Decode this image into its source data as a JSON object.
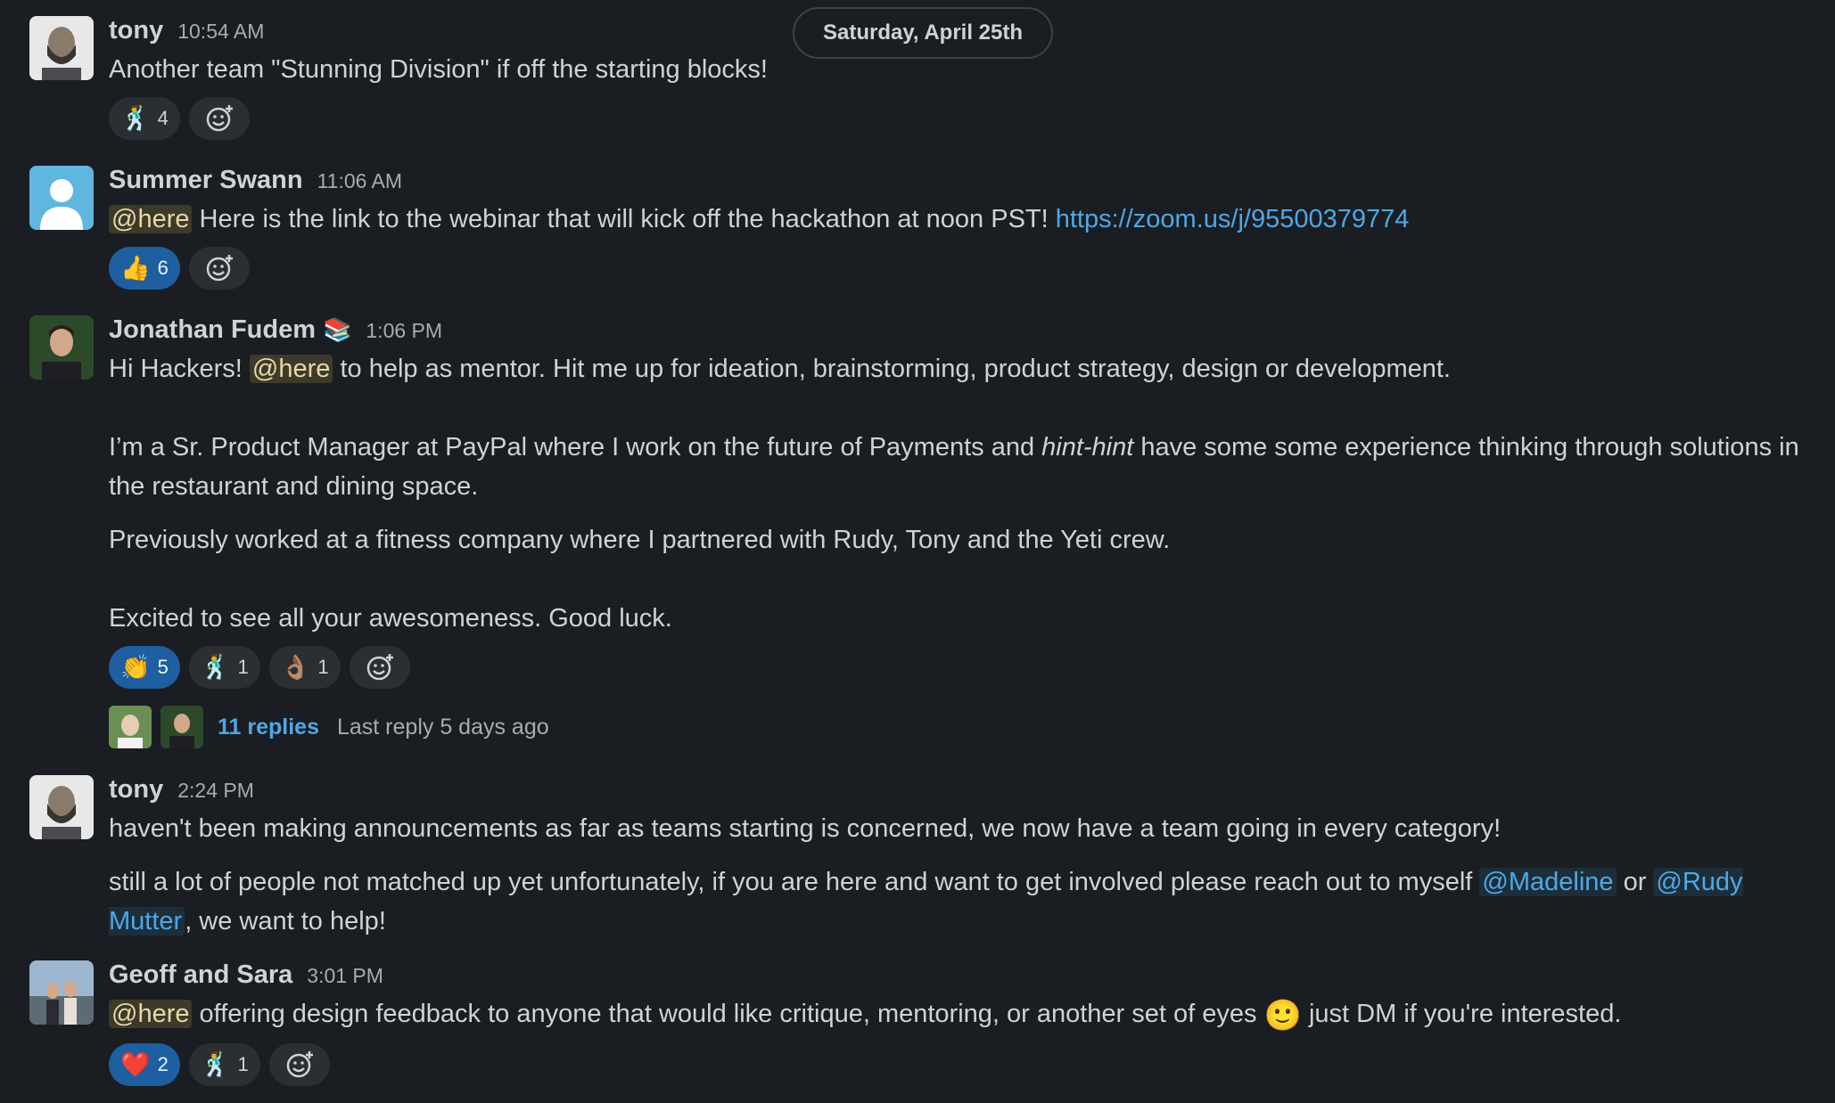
{
  "date_divider": "Saturday, April 25th",
  "messages": [
    {
      "author": "tony",
      "time": "10:54 AM",
      "text": "Another team \"Stunning Division\" if off the starting blocks!",
      "reactions": [
        {
          "emoji": "🕺",
          "count": "4"
        }
      ]
    },
    {
      "author": "Summer Swann",
      "time": "11:06 AM",
      "mention": "@here",
      "text": " Here is the link to the webinar that will kick off the hackathon at noon PST! ",
      "link": "https://zoom.us/j/95500379774",
      "reactions": [
        {
          "emoji": "👍",
          "count": "6"
        }
      ]
    },
    {
      "author": "Jonathan Fudem",
      "status_emoji": "📚",
      "time": "1:06 PM",
      "line1_a": "Hi Hackers! ",
      "line1_mention": "@here",
      "line1_b": " to help as mentor. Hit me up for ideation, brainstorming, product strategy, design or development.",
      "line2_a": "I’m a Sr. Product Manager at PayPal where I work on the future of Payments and ",
      "line2_em": "hint-hint",
      "line2_b": " have some some experience thinking through solutions in the restaurant and dining space.",
      "line3": "Previously worked at a fitness company where I partnered with Rudy, Tony and the Yeti crew.",
      "line4": "Excited to see all your awesomeness. Good luck.",
      "reactions": [
        {
          "emoji": "👏",
          "count": "5"
        },
        {
          "emoji": "🕺",
          "count": "1"
        },
        {
          "emoji": "👌🏽",
          "count": "1"
        }
      ],
      "thread": {
        "replies": "11 replies",
        "last_reply": "Last reply 5 days ago"
      }
    },
    {
      "author": "tony",
      "time": "2:24 PM",
      "line1": "haven't been making announcements as far as teams starting is concerned, we now have a team going in every category!",
      "line2_a": "still a lot of people not matched up yet unfortunately, if you are here and want to get involved please reach out to myself ",
      "mention1": "@Madeline",
      "line2_b": " or ",
      "mention2": "@Rudy Mutter",
      "line2_c": ", we want to help!"
    },
    {
      "author": "Geoff and Sara",
      "time": "3:01 PM",
      "mention": "@here",
      "text_a": " offering design feedback to anyone that would like critique, mentoring, or another set of eyes ",
      "inline_emoji": "🙂",
      "text_b": " just DM if you're interested.",
      "reactions": [
        {
          "emoji": "❤️",
          "count": "2"
        },
        {
          "emoji": "🕺",
          "count": "1"
        }
      ]
    }
  ]
}
